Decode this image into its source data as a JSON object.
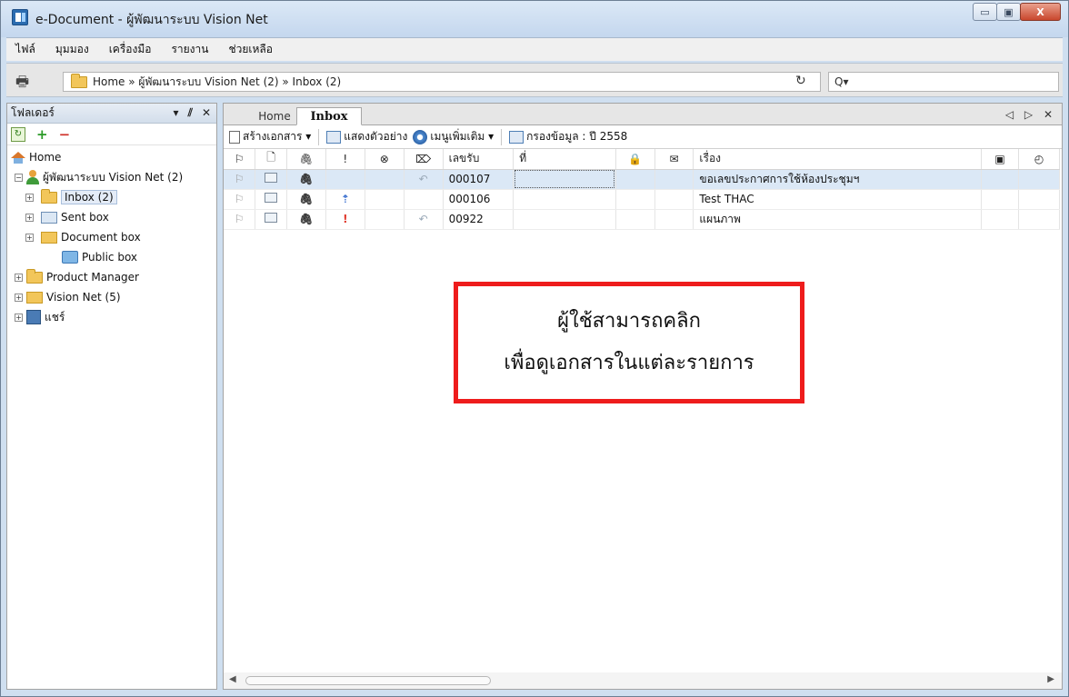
{
  "window": {
    "title": "e-Document - ผู้พัฒนาระบบ Vision Net",
    "minimize_label": "▭",
    "maximize_label": "▣",
    "close_label": "X"
  },
  "menu": {
    "items": [
      "ไฟล์",
      "มุมมอง",
      "เครื่องมือ",
      "รายงาน",
      "ช่วยเหลือ"
    ]
  },
  "address": {
    "path": "Home » ผู้พัฒนาระบบ Vision Net (2) » Inbox (2)",
    "search_placeholder": "Q▾"
  },
  "folder_panel": {
    "title": "โฟลเดอร์",
    "controls": [
      "▾",
      "⫽",
      "✕"
    ],
    "tree": [
      {
        "label": "Home",
        "icon": "home-icon"
      },
      {
        "label": "ผู้พัฒนาระบบ Vision Net (2)",
        "icon": "user-icon"
      },
      {
        "label": "Inbox (2)",
        "icon": "folder-icon"
      },
      {
        "label": "Sent box",
        "icon": "sent-box-icon"
      },
      {
        "label": "Document box",
        "icon": "document-box-icon"
      },
      {
        "label": "Public box",
        "icon": "public-box-icon"
      },
      {
        "label": "Product Manager",
        "icon": "folder-icon"
      },
      {
        "label": "Vision Net (5)",
        "icon": "folder-icon"
      },
      {
        "label": "แชร์",
        "icon": "share-icon"
      }
    ]
  },
  "tabs": {
    "home": "Home",
    "inbox": "Inbox",
    "controls": "◁ ▷ ✕"
  },
  "toolbar": {
    "create": "สร้างเอกสาร ▾",
    "preview": "แสดงตัวอย่าง",
    "more_menu": "เมนูเพิ่มเติม ▾",
    "filter": "กรองข้อมูล : ปี 2558"
  },
  "table": {
    "headers": {
      "flag": "⚐",
      "doc": "🗋",
      "attach": "🖇",
      "priority": "!",
      "cancel": "⊗",
      "reply": "⌦",
      "receipt_no": "เลขรับ",
      "ref_no": "ที่",
      "lock": "🔒",
      "mail": "✉",
      "subject": "เรื่อง",
      "print": "▣",
      "time": "◴"
    },
    "rows": [
      {
        "receipt_no": "000107",
        "subject": "ขอเลขประกาศการใช้ห้องประชุมฯ",
        "priority": ""
      },
      {
        "receipt_no": "000106",
        "subject": "Test THAC",
        "priority": "up"
      },
      {
        "receipt_no": "00922",
        "subject": "แผนภาพ",
        "priority": "high"
      }
    ]
  },
  "callout": {
    "line1": "ผู้ใช้สามารถคลิก",
    "line2": "เพื่อดูเอกสารในแต่ละรายการ",
    "border_color": "#ee1c1c"
  }
}
